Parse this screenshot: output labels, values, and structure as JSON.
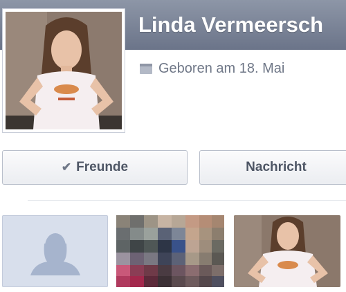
{
  "profile": {
    "name": "Linda Vermeersch",
    "birthday": "Geboren am 18. Mai"
  },
  "actions": {
    "friends_label": "Freunde",
    "message_label": "Nachricht"
  },
  "icons": {
    "birthday": "calendar-icon",
    "friends": "checkmark-icon",
    "placeholder": "person-silhouette-icon"
  },
  "colors": {
    "header": "#7b8497",
    "name_text": "#ffffff",
    "button_text": "#4e5665",
    "meta_text": "#6f7787",
    "placeholder_bg": "#d8dfec"
  },
  "photos": [
    {
      "kind": "placeholder"
    },
    {
      "kind": "pixelated"
    },
    {
      "kind": "photo"
    }
  ]
}
